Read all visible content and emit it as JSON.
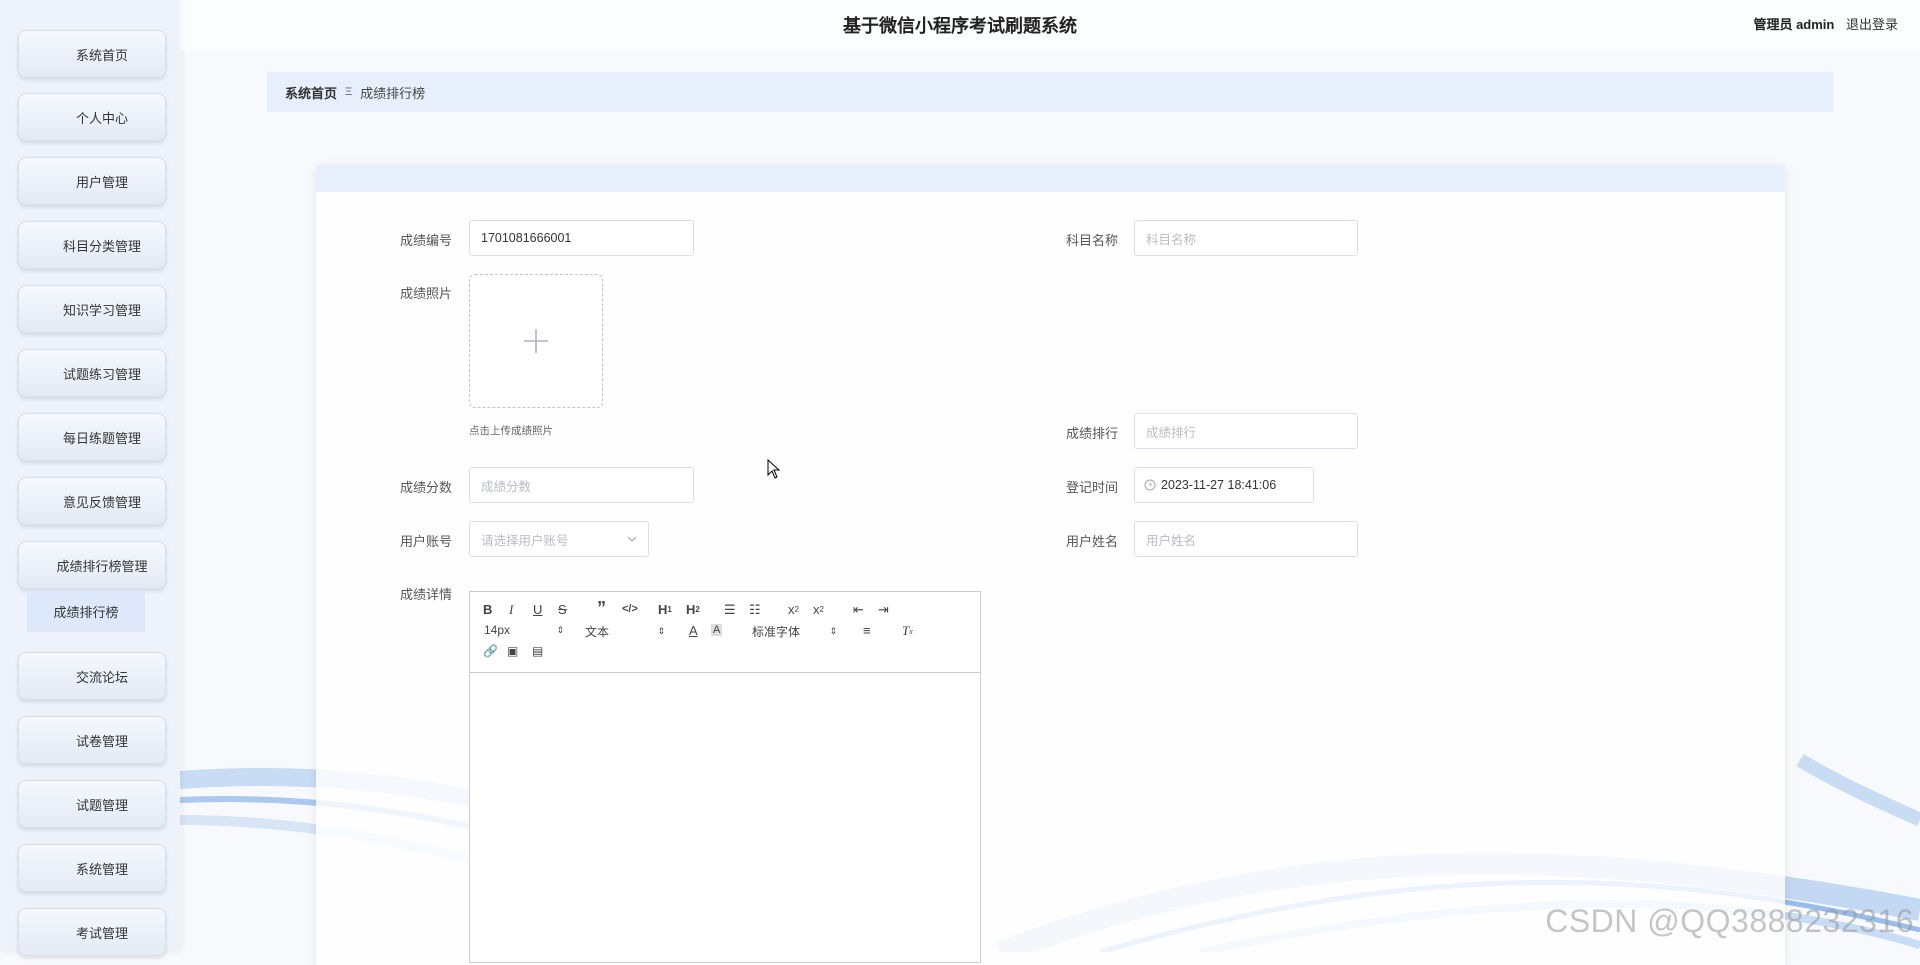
{
  "app": {
    "title": "基于微信小程序考试刷题系统",
    "user_role": "管理员 admin",
    "logout": "退出登录"
  },
  "sidebar": {
    "items": [
      {
        "label": "系统首页"
      },
      {
        "label": "个人中心"
      },
      {
        "label": "用户管理"
      },
      {
        "label": "科目分类管理"
      },
      {
        "label": "知识学习管理"
      },
      {
        "label": "试题练习管理"
      },
      {
        "label": "每日练题管理"
      },
      {
        "label": "意见反馈管理"
      },
      {
        "label": "成绩排行榜管理"
      },
      {
        "label": "交流论坛"
      },
      {
        "label": "试卷管理"
      },
      {
        "label": "试题管理"
      },
      {
        "label": "系统管理"
      },
      {
        "label": "考试管理"
      }
    ],
    "active_sub": "成绩排行榜"
  },
  "breadcrumb": {
    "home": "系统首页",
    "separator": "Ξ",
    "current": "成绩排行榜"
  },
  "form": {
    "score_no": {
      "label": "成绩编号",
      "value": "1701081666001"
    },
    "subject_name": {
      "label": "科目名称",
      "placeholder": "科目名称"
    },
    "score_photo": {
      "label": "成绩照片",
      "hint": "点击上传成绩照片"
    },
    "score_rank": {
      "label": "成绩排行",
      "placeholder": "成绩排行"
    },
    "score": {
      "label": "成绩分数",
      "placeholder": "成绩分数"
    },
    "register_time": {
      "label": "登记时间",
      "value": "2023-11-27 18:41:06"
    },
    "user_account": {
      "label": "用户账号",
      "placeholder": "请选择用户账号"
    },
    "user_name": {
      "label": "用户姓名",
      "placeholder": "用户姓名"
    },
    "detail": {
      "label": "成绩详情"
    }
  },
  "editor": {
    "font_size": "14px",
    "header_select": "文本",
    "font_family": "标准字体"
  },
  "watermark": "CSDN @QQ3888232316"
}
